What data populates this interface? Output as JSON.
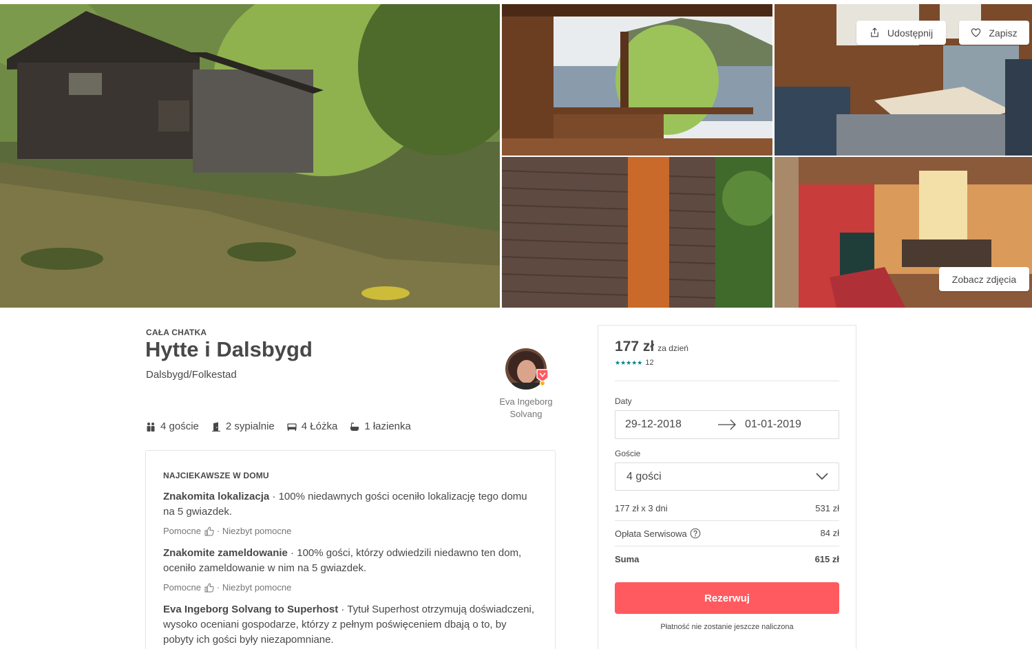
{
  "gallery": {
    "share_label": "Udostępnij",
    "save_label": "Zapisz",
    "view_photos_label": "Zobacz zdjęcia"
  },
  "listing": {
    "type": "CAŁA CHATKA",
    "title": "Hytte i Dalsbygd",
    "location": "Dalsbygd/Folkestad",
    "host_name_line1": "Eva Ingeborg",
    "host_name_line2": "Solvang",
    "amenities": [
      {
        "icon": "guests-icon",
        "label": "4 goście"
      },
      {
        "icon": "door-icon",
        "label": "2 sypialnie"
      },
      {
        "icon": "bed-icon",
        "label": "4 Łóżka"
      },
      {
        "icon": "bath-icon",
        "label": "1 łazienka"
      }
    ]
  },
  "highlights": {
    "heading": "NAJCIEKAWSZE W DOMU",
    "helpful_label": "Pomocne",
    "not_helpful_label": "· Niezbyt pomocne",
    "items": [
      {
        "title": "Znakomita lokalizacja",
        "text": " · 100% niedawnych gości oceniło lokalizację tego domu na 5 gwiazdek."
      },
      {
        "title": "Znakomite zameldowanie",
        "text": " · 100% gości, którzy odwiedzili niedawno ten dom, oceniło zameldowanie w nim na 5 gwiazdek."
      },
      {
        "title": "Eva Ingeborg Solvang to Superhost",
        "text": " · Tytuł Superhost otrzymują doświadczeni, wysoko oceniani gospodarze, którzy z pełnym poświęceniem dbają o to, by pobyty ich gości były niezapomniane."
      }
    ]
  },
  "booking": {
    "price": "177 zł",
    "price_unit": "za dzień",
    "stars": "★★★★★",
    "reviews_count": "12",
    "dates_label": "Daty",
    "check_in": "29-12-2018",
    "check_out": "01-01-2019",
    "guests_label": "Goście",
    "guests_value": "4 gości",
    "nights_line": "177 zł x 3 dni",
    "nights_total": "531 zł",
    "service_fee_label": "Opłata Serwisowa",
    "service_fee": "84 zł",
    "total_label": "Suma",
    "total": "615 zł",
    "reserve_label": "Rezerwuj",
    "no_charge_note": "Płatność nie zostanie jeszcze naliczona"
  },
  "colors": {
    "accent": "#ff5a5f",
    "stars": "#008489",
    "text": "#484848",
    "muted": "#767676",
    "border": "#e4e4e4"
  }
}
